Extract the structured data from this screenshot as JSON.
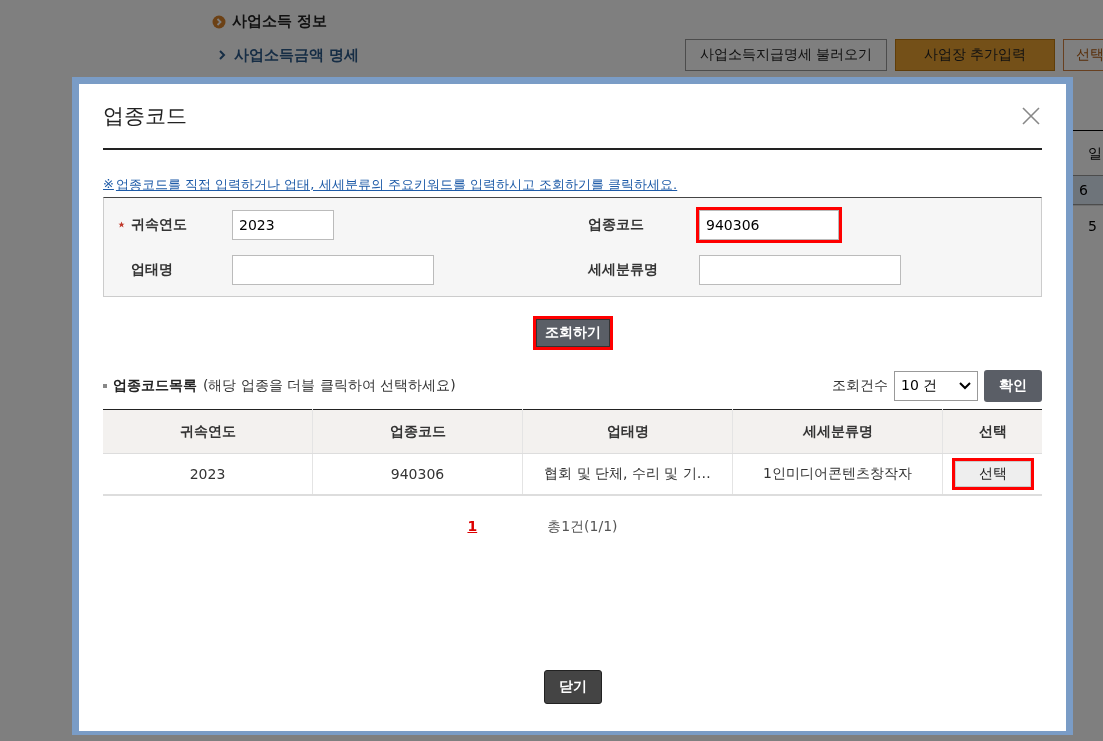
{
  "page": {
    "section_title": "사업소득 정보",
    "subsection_title": "사업소득금액 명세",
    "buttons": [
      {
        "label": "사업소득지급명세 불러오기",
        "kind": "plain"
      },
      {
        "label": "사업장 추가입력",
        "kind": "primary"
      },
      {
        "label": "선택",
        "kind": "outline"
      }
    ],
    "side_table": {
      "header": "일",
      "rows": [
        {
          "text": "6",
          "selected": true
        },
        {
          "text": "5",
          "selected": false
        }
      ]
    }
  },
  "dialog": {
    "title": "업종코드",
    "notice_mark": "※",
    "notice": "업종코드를 직접 입력하거나 업태, 세세분류의 주요키워드를 입력하시고 조회하기를 클릭하세요.",
    "form": [
      {
        "label": "귀속연도",
        "required": true,
        "value": "2023",
        "highlighted": false
      },
      {
        "label": "업종코드",
        "required": false,
        "value": "940306",
        "highlighted": true
      },
      {
        "label": "업태명",
        "required": false,
        "highlighted": false
      },
      {
        "label": "세세분류명",
        "required": false,
        "highlighted": false
      }
    ],
    "search_button": {
      "label": "조회하기",
      "highlighted": true
    },
    "list": {
      "title": "업종코드목록",
      "hint": "(해당 업종을 더블 클릭하여 선택하세요)",
      "count_label": "조회건수",
      "count_value": "10 건",
      "confirm_button": "확인",
      "columns": [
        "귀속연도",
        "업종코드",
        "업태명",
        "세세분류명",
        "선택"
      ],
      "rows": [
        {
          "cells": [
            "2023",
            "940306",
            "협회 및 단체, 수리 및 기…",
            "1인미디어콘텐츠창작자"
          ],
          "action": "선택",
          "highlighted": true
        }
      ]
    },
    "pagination": {
      "pages": [
        {
          "label": "1",
          "selected": true
        }
      ],
      "total": "총1건(1/1)"
    },
    "close_button": "닫기"
  }
}
